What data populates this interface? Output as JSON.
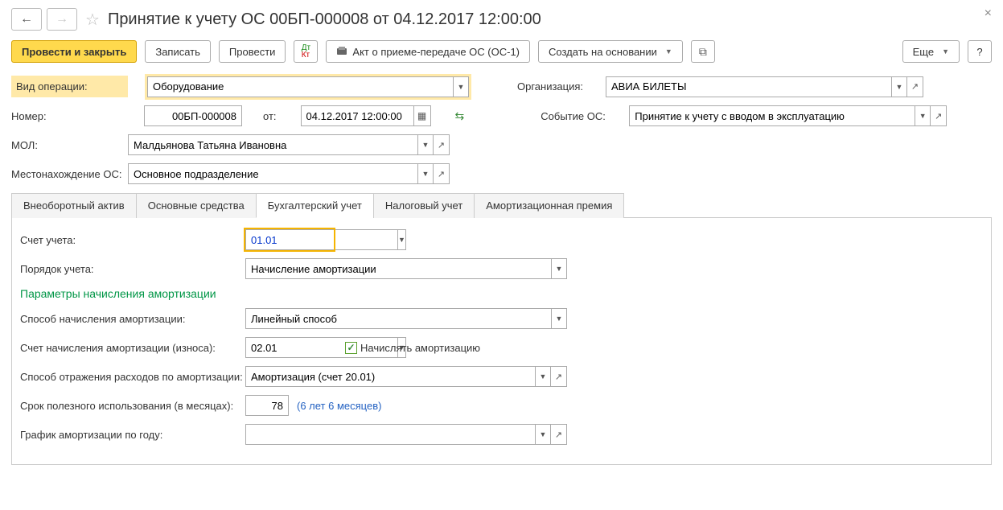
{
  "title": "Принятие к учету ОС 00БП-000008 от 04.12.2017 12:00:00",
  "toolbar": {
    "post_close": "Провести и закрыть",
    "save": "Записать",
    "post": "Провести",
    "print_act": "Акт о приеме-передаче ОС (ОС-1)",
    "create_based": "Создать на основании",
    "more": "Еще",
    "help": "?"
  },
  "fields": {
    "op_type_label": "Вид операции:",
    "op_type_value": "Оборудование",
    "org_label": "Организация:",
    "org_value": "АВИА БИЛЕТЫ",
    "number_label": "Номер:",
    "number_value": "00БП-000008",
    "from_label": "от:",
    "date_value": "04.12.2017 12:00:00",
    "event_label": "Событие ОС:",
    "event_value": "Принятие к учету с вводом в эксплуатацию",
    "mol_label": "МОЛ:",
    "mol_value": "Малдьянова Татьяна Ивановна",
    "location_label": "Местонахождение ОС:",
    "location_value": "Основное подразделение"
  },
  "tabs": [
    "Внеоборотный актив",
    "Основные средства",
    "Бухгалтерский учет",
    "Налоговый учет",
    "Амортизационная премия"
  ],
  "accounting": {
    "account_label": "Счет учета:",
    "account_value": "01.01",
    "order_label": "Порядок учета:",
    "order_value": "Начисление амортизации",
    "section_title": "Параметры начисления амортизации",
    "method_label": "Способ начисления амортизации:",
    "method_value": "Линейный способ",
    "depr_account_label": "Счет начисления амортизации (износа):",
    "depr_account_value": "02.01",
    "charge_checkbox": "Начислять амортизацию",
    "expense_label": "Способ отражения расходов по амортизации:",
    "expense_value": "Амортизация (счет 20.01)",
    "useful_life_label": "Срок полезного использования (в месяцах):",
    "useful_life_value": "78",
    "useful_life_hint": "(6 лет 6 месяцев)",
    "schedule_label": "График амортизации по году:",
    "schedule_value": ""
  }
}
